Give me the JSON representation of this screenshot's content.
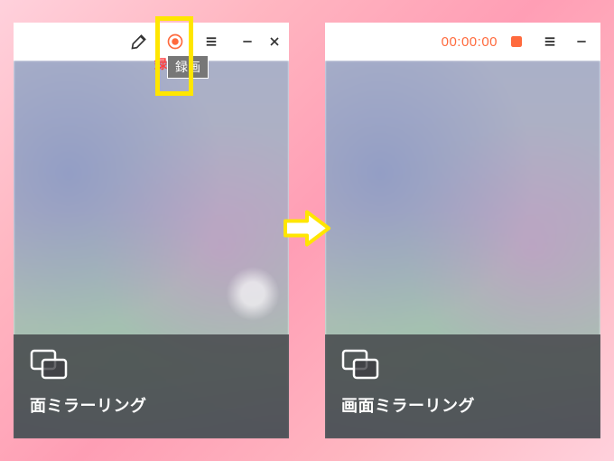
{
  "left": {
    "tooltip_label": "録画",
    "tooltip_prefix": "録",
    "bottom_label": "面ミラーリング",
    "icons": {
      "brush": "brush-icon",
      "record": "record-icon",
      "menu": "menu-icon",
      "minimize": "minimize-icon",
      "close": "close-icon"
    }
  },
  "right": {
    "timer": "00:00:00",
    "bottom_label": "画面ミラーリング",
    "icons": {
      "stop": "stop-icon",
      "menu": "menu-icon",
      "minimize": "minimize-icon"
    }
  },
  "colors": {
    "accent": "#ff6a3d",
    "highlight": "#ffe600"
  }
}
